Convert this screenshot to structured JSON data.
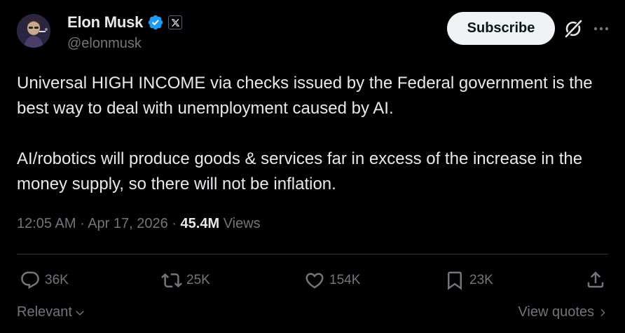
{
  "author": {
    "name": "Elon Musk",
    "handle": "@elonmusk",
    "verified": true,
    "verified_color": "#1d9bf0",
    "affiliate_badge": "x-logo-icon"
  },
  "header": {
    "subscribe_label": "Subscribe"
  },
  "tweet": {
    "paragraphs": [
      "Universal HIGH INCOME via checks issued by the Federal government is the best way to deal with unemployment caused by AI.",
      "AI/robotics will produce goods & services far in excess of the increase in the money supply, so there will not be inflation."
    ]
  },
  "meta": {
    "time": "12:05 AM",
    "separator": "·",
    "date": "Apr 17, 2026",
    "views_count": "45.4M",
    "views_label": "Views"
  },
  "actions": {
    "replies": "36K",
    "reposts": "25K",
    "likes": "154K",
    "bookmarks": "23K"
  },
  "footer": {
    "sort_label": "Relevant",
    "view_quotes_label": "View quotes"
  },
  "colors": {
    "background": "#000000",
    "text_primary": "#e7e9ea",
    "text_secondary": "#71767b",
    "divider": "#2f3336",
    "accent": "#1d9bf0"
  }
}
